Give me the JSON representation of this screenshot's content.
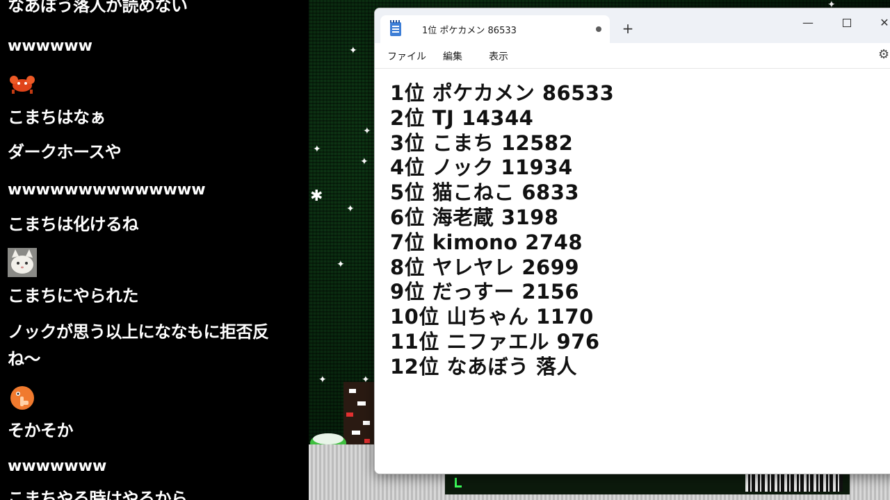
{
  "chat": {
    "messages": [
      {
        "type": "text",
        "text": "なあぼう落人が読めない"
      },
      {
        "type": "text",
        "text": "wwwwww"
      },
      {
        "type": "emote",
        "emote": "crab-emote"
      },
      {
        "type": "text",
        "text": "こまちはなぁ"
      },
      {
        "type": "text",
        "text": "ダークホースや"
      },
      {
        "type": "text",
        "text": "wwwwwwwwwwwwww"
      },
      {
        "type": "text",
        "text": "こまちは化けるね"
      },
      {
        "type": "emote",
        "emote": "cat-emote"
      },
      {
        "type": "text",
        "text": "こまちにやられた"
      },
      {
        "type": "text",
        "text": "ノックが思う以上にななもに拒否反"
      },
      {
        "type": "text",
        "text": "ね～"
      },
      {
        "type": "emote",
        "emote": "pointing-blob-emote"
      },
      {
        "type": "text",
        "text": "そかそか"
      },
      {
        "type": "text",
        "text": "wwwwwww"
      },
      {
        "type": "text",
        "text": "こまちやる時はやるから"
      }
    ]
  },
  "notepad": {
    "tab_title": "1位 ポケカメン 86533",
    "new_tab_label": "+",
    "window_controls": {
      "minimize": "—",
      "close": "✕"
    },
    "menu": {
      "file": "ファイル",
      "edit": "編集",
      "view": "表示"
    },
    "settings_glyph": "⚙",
    "lines": [
      "1位 ポケカメン 86533",
      "2位 TJ 14344",
      "3位 こまち 12582",
      "4位 ノック 11934",
      "5位 猫こねこ 6833",
      "6位 海老蔵 3198",
      "7位 kimono 2748",
      "8位 ヤレヤレ 2699",
      "9位 だっすー 2156",
      "10位 山ちゃん 1170",
      "11位 ニファエル 976",
      "12位 なあぼう 落人"
    ]
  },
  "colors": {
    "chat_bg": "#000000",
    "chat_text": "#ffffff",
    "game_bg": "#06200b",
    "notepad_bg": "#ffffff",
    "titlebar_bg": "#eef1f6"
  }
}
